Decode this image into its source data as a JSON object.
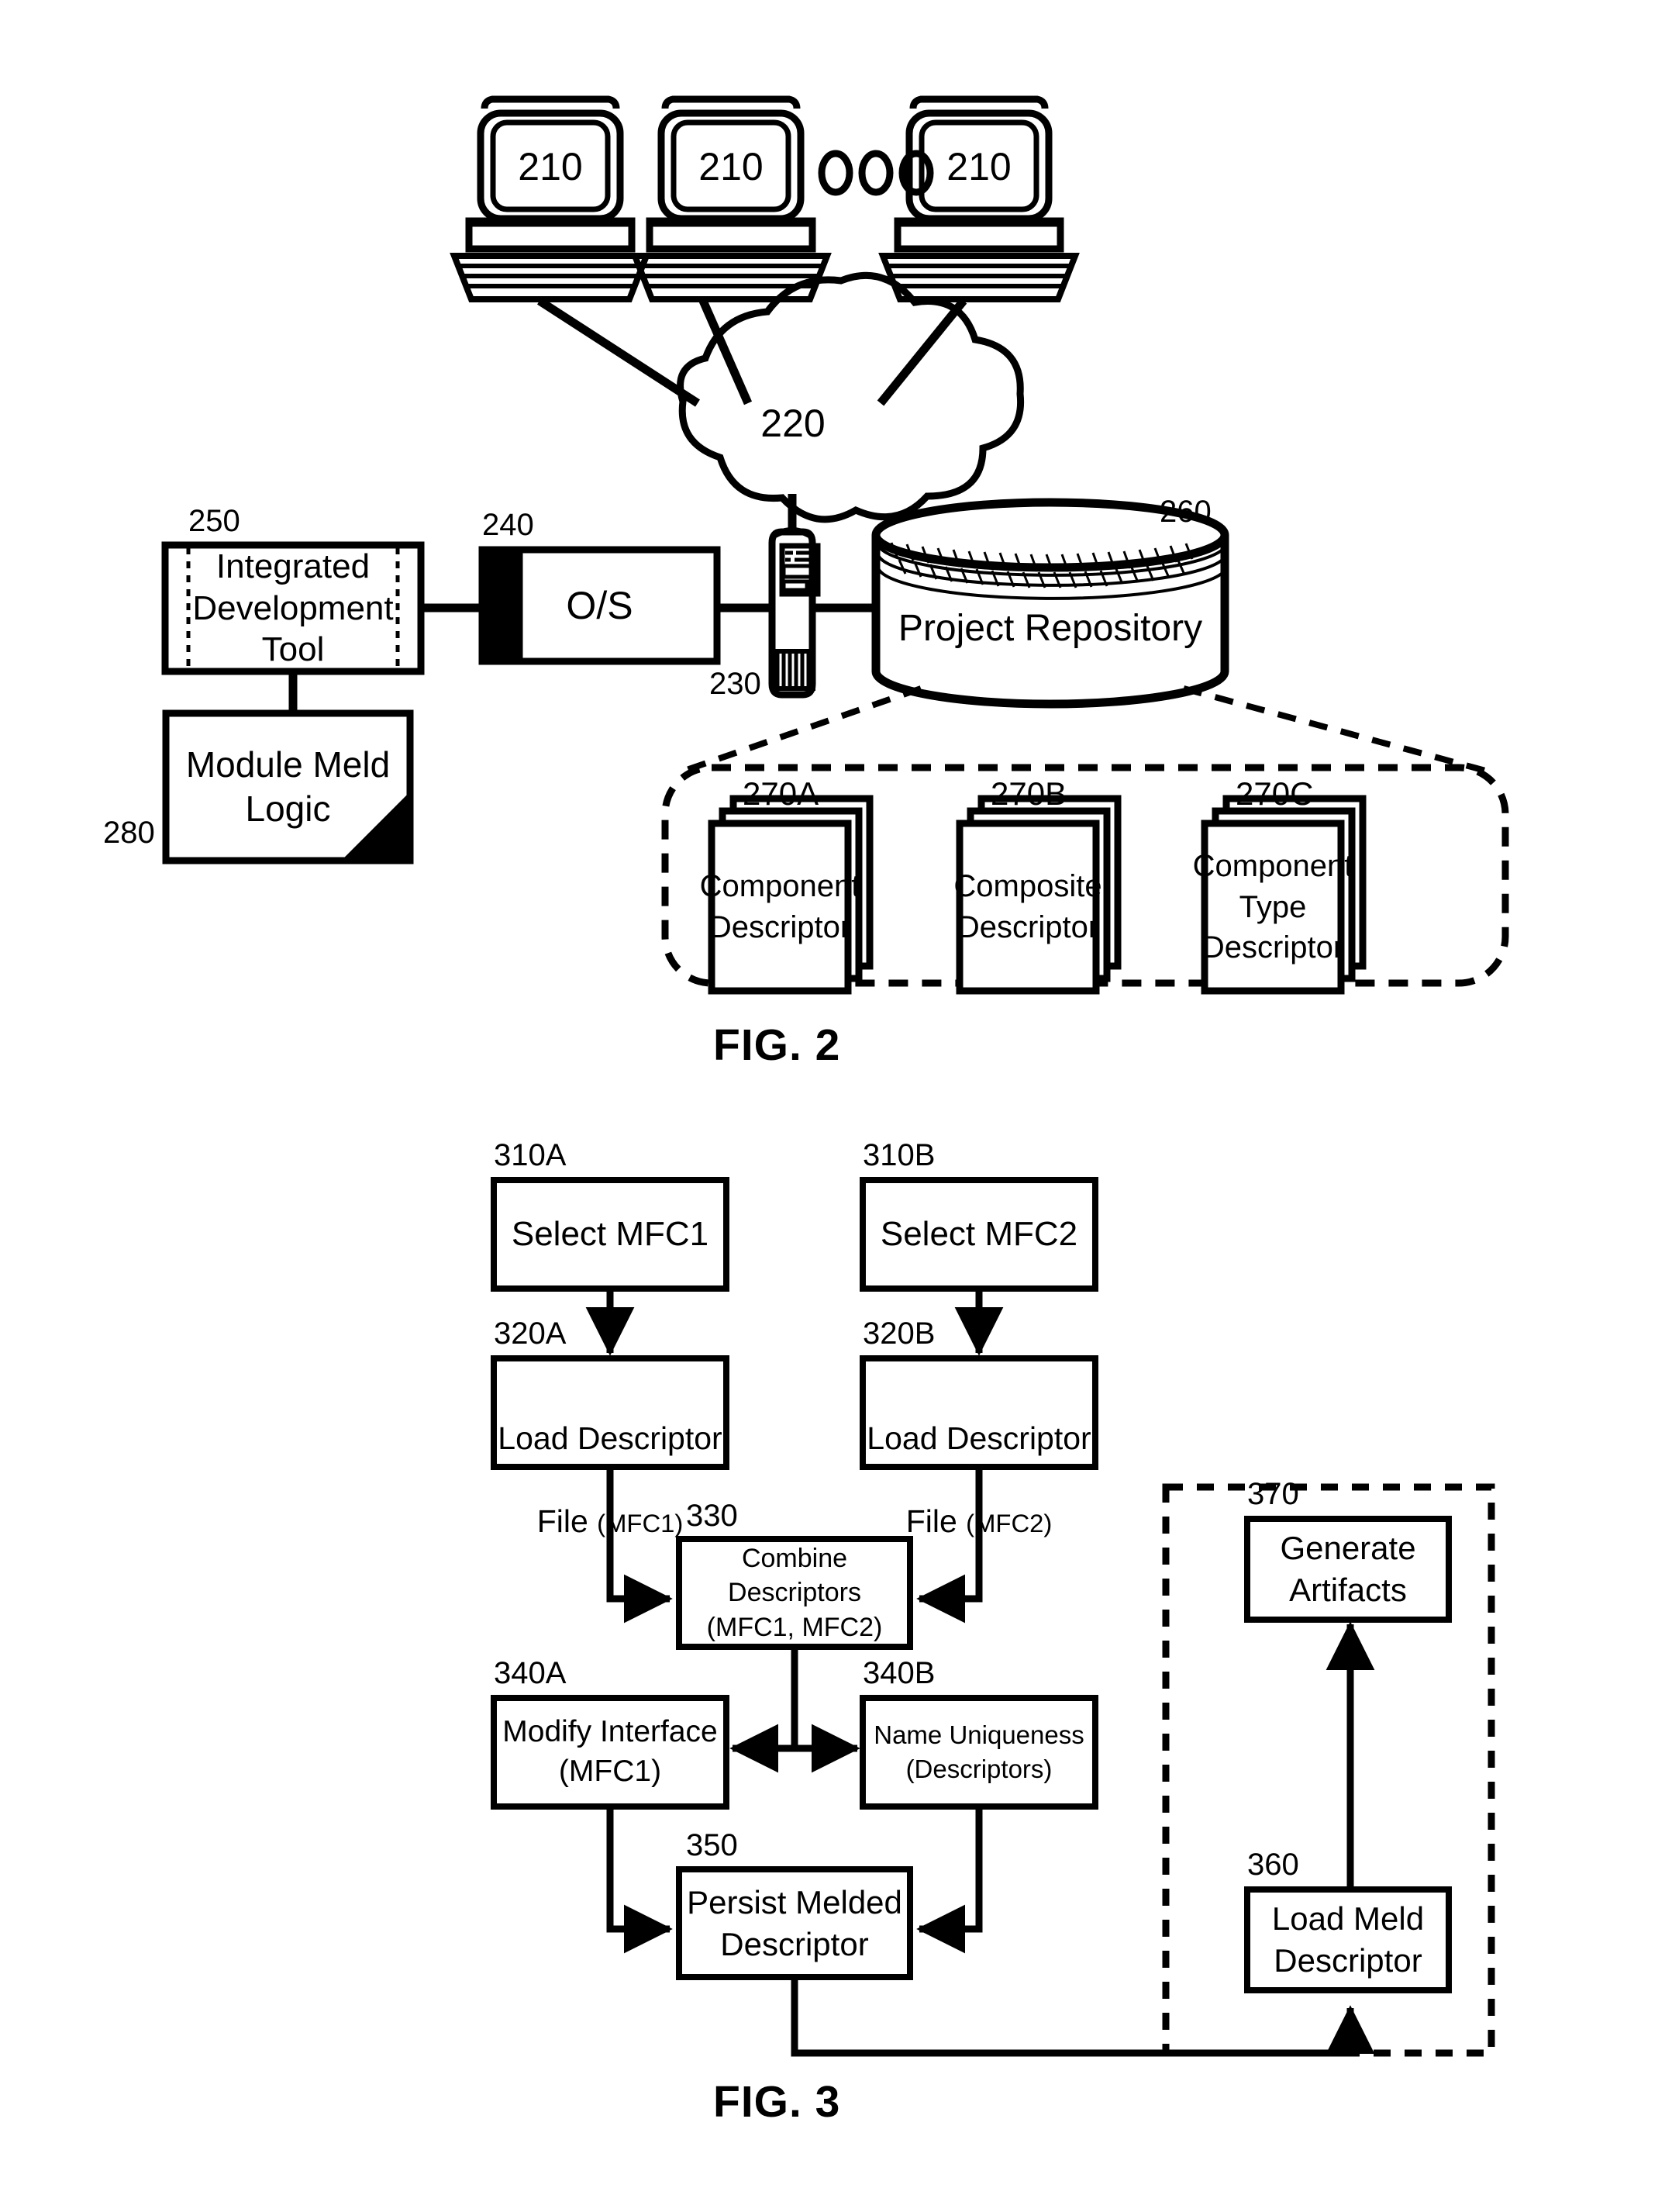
{
  "figures": [
    {
      "id": "fig2",
      "caption": "FIG. 2",
      "terminals": [
        {
          "ref": "210"
        },
        {
          "ref": "210"
        },
        {
          "ref": "210"
        }
      ],
      "ellipsis": "ooo",
      "network": {
        "ref": "220"
      },
      "server": {
        "ref": "230"
      },
      "os_box": {
        "ref": "240",
        "label": "O/S"
      },
      "ide_box": {
        "ref": "250",
        "label": "Integrated\nDevelopment\nTool"
      },
      "meld_logic_box": {
        "ref": "280",
        "label": "Module Meld\nLogic"
      },
      "repository": {
        "ref": "260",
        "label": "Project Repository"
      },
      "descriptors": [
        {
          "ref": "270A",
          "label": "Component\nDescriptor"
        },
        {
          "ref": "270B",
          "label": "Composite\nDescriptor"
        },
        {
          "ref": "270C",
          "label": "Component\nType\nDescriptor"
        }
      ]
    },
    {
      "id": "fig3",
      "caption": "FIG. 3",
      "steps": [
        {
          "ref": "310A",
          "label": "Select MFC1"
        },
        {
          "ref": "310B",
          "label": "Select MFC2"
        },
        {
          "ref": "320A",
          "label_main": "Load Descriptor",
          "label_sub": "File ",
          "label_paren": "(MFC1)"
        },
        {
          "ref": "320B",
          "label_main": "Load Descriptor",
          "label_sub": "File ",
          "label_paren": "(MFC2)"
        },
        {
          "ref": "330",
          "label": "Combine\nDescriptors\n(MFC1, MFC2)"
        },
        {
          "ref": "340A",
          "label": "Modify Interface\n(MFC1)"
        },
        {
          "ref": "340B",
          "label": "Name Uniqueness\n(Descriptors)"
        },
        {
          "ref": "350",
          "label": "Persist Melded\nDescriptor"
        },
        {
          "ref": "360",
          "label": "Load Meld\nDescriptor"
        },
        {
          "ref": "370",
          "label": "Generate\nArtifacts"
        }
      ]
    }
  ],
  "colors": {
    "ink": "#000000",
    "paper": "#ffffff"
  }
}
